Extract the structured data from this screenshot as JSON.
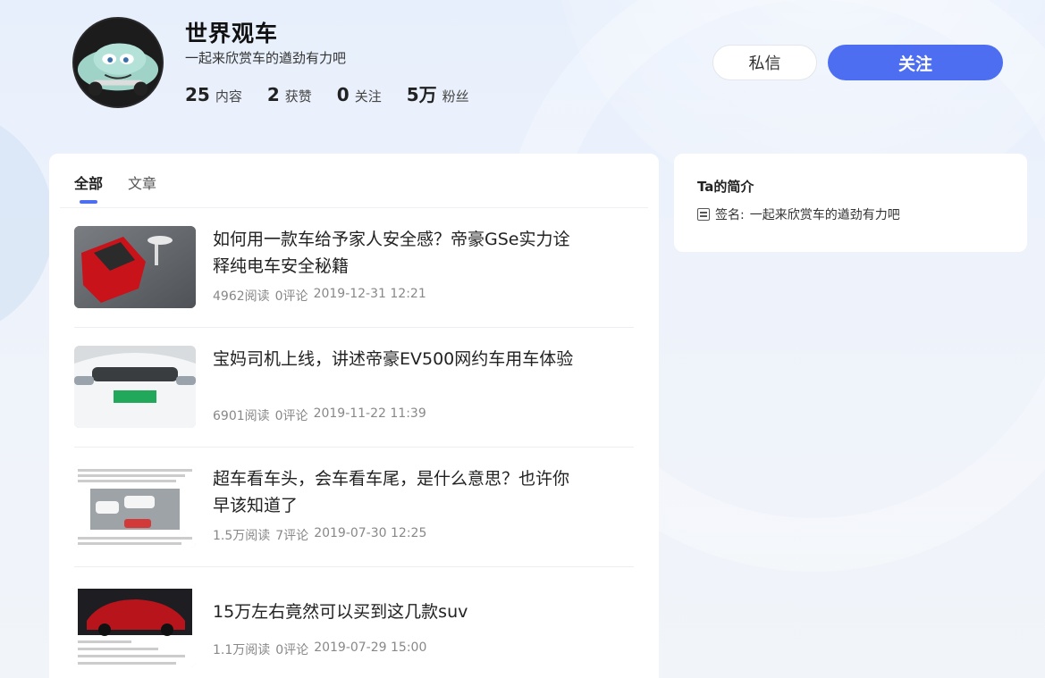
{
  "profile": {
    "name": "世界观车",
    "tagline": "一起来欣赏车的遒劲有力吧",
    "stats": [
      {
        "num": "25",
        "label": "内容"
      },
      {
        "num": "2",
        "label": "获赞"
      },
      {
        "num": "0",
        "label": "关注"
      },
      {
        "num": "5万",
        "label": "粉丝"
      }
    ]
  },
  "actions": {
    "message_label": "私信",
    "follow_label": "关注",
    "accent_color": "#4e6ef2"
  },
  "tabs": [
    {
      "label": "全部",
      "active": true
    },
    {
      "label": "文章",
      "active": false
    }
  ],
  "articles": [
    {
      "title": "如何用一款车给予家人安全感？帝豪GSe实力诠释纯电车安全秘籍",
      "reads": "4962阅读",
      "comments": "0评论",
      "date": "2019-12-31 12:21"
    },
    {
      "title": "宝妈司机上线，讲述帝豪EV500网约车用车体验",
      "reads": "6901阅读",
      "comments": "0评论",
      "date": "2019-11-22 11:39"
    },
    {
      "title": "超车看车头，会车看车尾，是什么意思？也许你早该知道了",
      "reads": "1.5万阅读",
      "comments": "7评论",
      "date": "2019-07-30 12:25"
    },
    {
      "title": "15万左右竟然可以买到这几款suv",
      "reads": "1.1万阅读",
      "comments": "0评论",
      "date": "2019-07-29 15:00"
    }
  ],
  "sidebar": {
    "title": "Ta的简介",
    "signature_label": "签名:",
    "signature": "一起来欣赏车的遒劲有力吧"
  }
}
